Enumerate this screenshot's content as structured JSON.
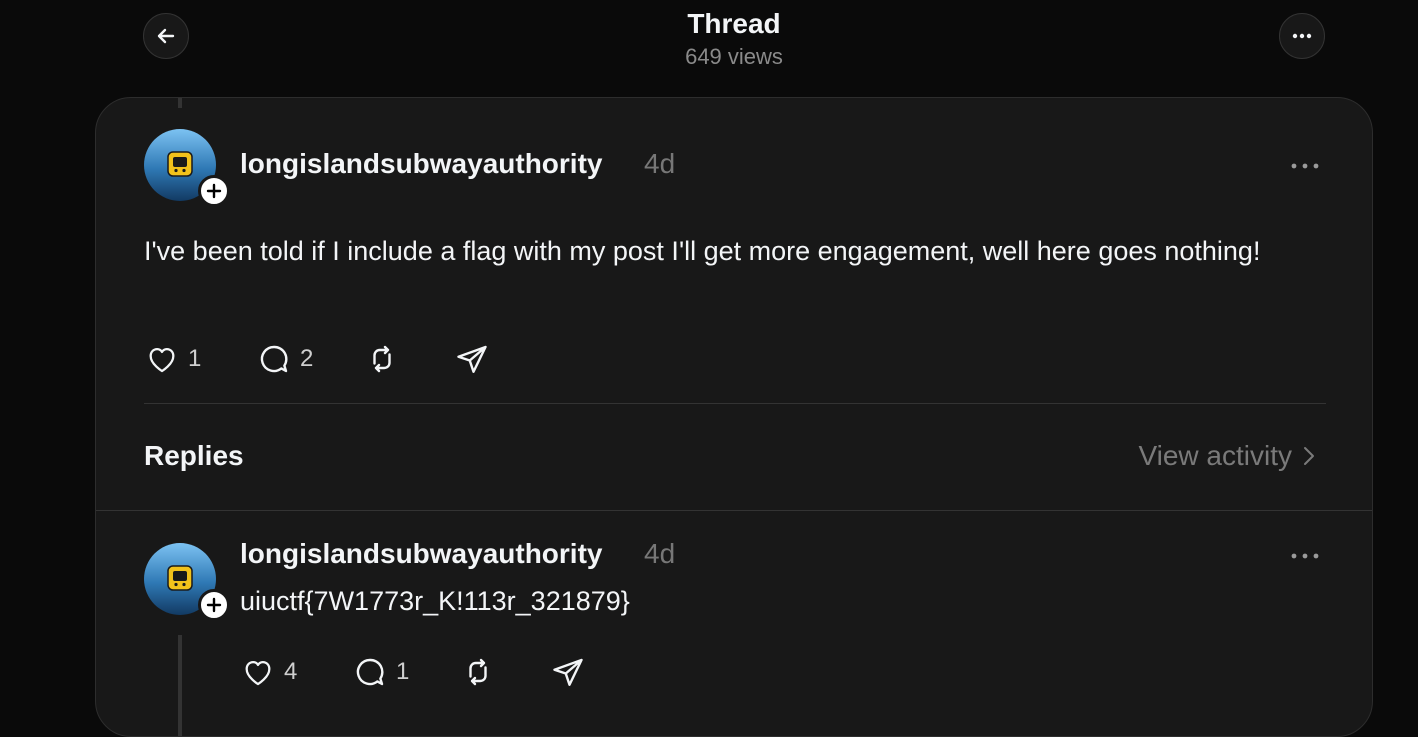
{
  "header": {
    "title": "Thread",
    "views": "649 views",
    "back_icon": "arrow-left-icon",
    "more_icon": "more-horizontal-icon"
  },
  "post": {
    "username": "longislandsubwayauthority",
    "time": "4d",
    "text": "I've been told if I include a flag with my post I'll get more engagement, well here goes nothing!",
    "likes": "1",
    "replies": "2"
  },
  "replies_section": {
    "label": "Replies",
    "view_activity": "View activity"
  },
  "reply": {
    "username": "longislandsubwayauthority",
    "time": "4d",
    "text": "uiuctf{7W1773r_K!113r_321879}",
    "likes": "4",
    "replies": "1"
  },
  "colors": {
    "background": "#0a0a0a",
    "card": "#181818",
    "text": "#f3f5f7",
    "muted": "#777777"
  }
}
